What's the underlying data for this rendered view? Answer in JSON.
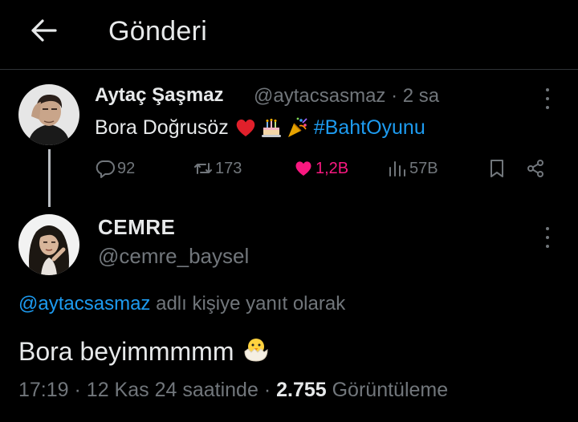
{
  "header": {
    "title": "Gönderi",
    "back_icon": "arrow-left-icon"
  },
  "parent_tweet": {
    "author_name": "Aytaç Şaşmaz",
    "author_handle": "@aytacsasmaz",
    "separator": "·",
    "time_ago": "2 sa",
    "text": "Bora Doğrusöz",
    "emojis": [
      "heart-emoji",
      "birthday-cake-emoji",
      "party-popper-emoji"
    ],
    "hashtag": "#BahtOyunu",
    "actions": {
      "replies": "92",
      "retweets": "173",
      "likes": "1,2B",
      "views": "57B"
    }
  },
  "reply_tweet": {
    "author_name": "CEMRE",
    "author_handle": "@cemre_baysel",
    "replying_mention": "@aytacsasmaz",
    "replying_suffix": " adlı kişiye yanıt olarak",
    "text": "Bora beyimmmmm",
    "emoji": "hatching-chick-emoji",
    "time": "17:19",
    "date": "12 Kas 24 saatinde",
    "views_count": "2.755",
    "views_label": "Görüntüleme"
  },
  "colors": {
    "background": "#000000",
    "text_primary": "#e7e9ea",
    "text_secondary": "#71767b",
    "accent_blue": "#1d9bf0",
    "like_pink": "#f91880"
  }
}
